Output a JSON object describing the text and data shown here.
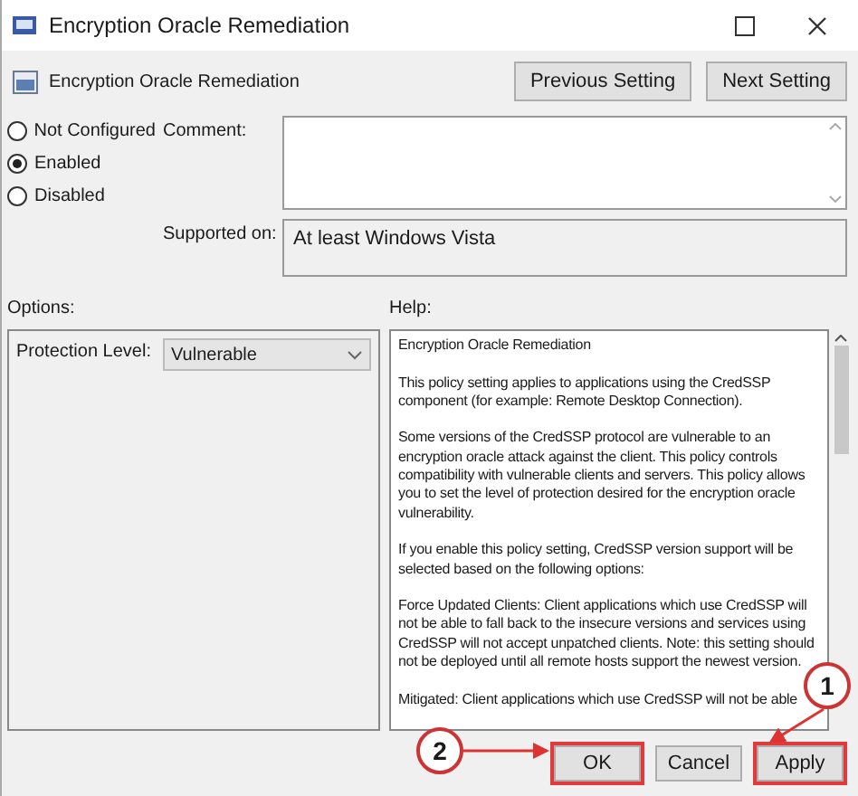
{
  "window": {
    "title": "Encryption Oracle Remediation"
  },
  "setting_name": "Encryption Oracle Remediation",
  "nav_buttons": [
    "Previous Setting",
    "Next Setting"
  ],
  "radios": [
    {
      "label": "Not Configured",
      "selected": false
    },
    {
      "label": "Enabled",
      "selected": true
    },
    {
      "label": "Disabled",
      "selected": false
    }
  ],
  "comment": {
    "label": "Comment:"
  },
  "supported_on": {
    "label": "Supported on:",
    "value": "At least Windows Vista"
  },
  "options": {
    "label": "Options:",
    "protection_level": {
      "label": "Protection Level:",
      "value": "Vulnerable"
    }
  },
  "help": {
    "label": "Help:",
    "paragraphs": [
      "Encryption Oracle Remediation",
      "This policy setting applies to applications using the CredSSP component (for example: Remote Desktop Connection).",
      "Some versions of the CredSSP protocol are vulnerable to an encryption oracle attack against the client.  This policy controls compatibility with vulnerable clients and servers.  This policy allows you to set the level of protection desired for the encryption oracle vulnerability.",
      "If you enable this policy setting, CredSSP version support will be selected based on the following options:",
      "Force Updated Clients: Client applications which use CredSSP will not be able to fall back to the insecure versions and services using CredSSP will not accept unpatched clients. Note: this setting should not be deployed until all remote hosts support the newest version.",
      "Mitigated: Client applications which use CredSSP will not be able"
    ]
  },
  "buttons": [
    {
      "label": "OK",
      "highlighted": true,
      "callout": "2"
    },
    {
      "label": "Cancel",
      "highlighted": false
    },
    {
      "label": "Apply",
      "highlighted": true,
      "callout": "1"
    }
  ]
}
